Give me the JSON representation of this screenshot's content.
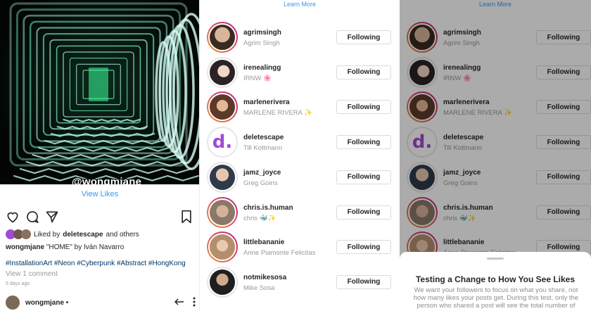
{
  "post": {
    "photo_tag": "@wongmjane",
    "view_likes": "View Likes",
    "liked_by_prefix": "Liked by",
    "liked_by_user": "deletescape",
    "liked_by_suffix": "and others",
    "caption_user": "wongmjane",
    "caption_text": "\"HOME\" by Iván Navarro",
    "hashtags": "#InstallationArt #Neon #Cyberpunk #Abstract #HongKong",
    "view_comment": "View 1 comment",
    "time_ago": "5 days ago",
    "comment_user": "wongmjane •"
  },
  "likers": {
    "learn_more": "Learn More",
    "follow_button": "Following",
    "items": [
      {
        "username": "agrimsingh",
        "fullname": "Agrim Singh",
        "avatar": "agrim-avatar",
        "ring": true
      },
      {
        "username": "irenealingg",
        "fullname": "IRNW 🌸",
        "avatar": "irene-avatar",
        "ring": false
      },
      {
        "username": "marlenerivera",
        "fullname": "MARLENE RIVERA ✨",
        "avatar": "marlene-avatar",
        "ring": true
      },
      {
        "username": "deletescape",
        "fullname": "Till Kottmann",
        "avatar": "d-logo",
        "ring": false
      },
      {
        "username": "jamz_joyce",
        "fullname": "Greg Goins",
        "avatar": "greg-avatar",
        "ring": false
      },
      {
        "username": "chris.is.human",
        "fullname": "chris 🐳✨",
        "avatar": "chris-avatar",
        "ring": true
      },
      {
        "username": "littlebananie",
        "fullname": "Anne Piamonte Felicitas",
        "avatar": "anne-avatar",
        "ring": true
      },
      {
        "username": "notmikesosa",
        "fullname": "Mike Sosa",
        "avatar": "mike-avatar",
        "ring": false
      }
    ]
  },
  "sheet": {
    "title": "Testing a Change to How You See Likes",
    "body": "We want your followers to focus on what you share, not how many likes your posts get. During this test, only the person who shared a post will see the total number of"
  },
  "colors": {
    "link_blue": "#3897f0",
    "hashtag_blue": "#003569",
    "ring_gradient_start": "#f09433",
    "ring_gradient_end": "#bc1888",
    "deletescape_purple": "#a24ad6"
  }
}
